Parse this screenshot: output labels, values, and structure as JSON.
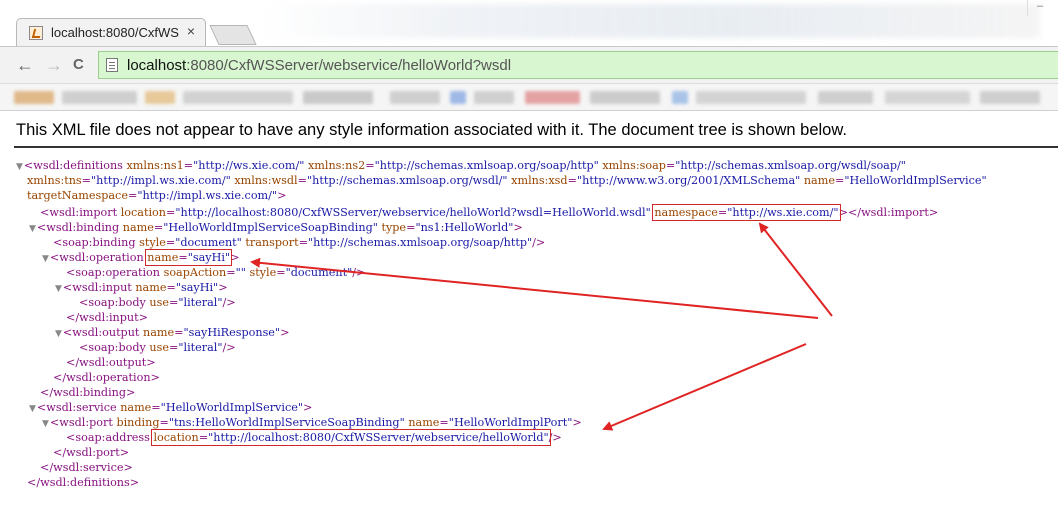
{
  "browser": {
    "tab_title": "localhost:8080/CxfWS",
    "tab_close": "×",
    "url_host": "localhost",
    "url_path": ":8080/CxfWSServer/webservice/helloWorld?wsdl",
    "back_glyph": "←",
    "forward_glyph": "→",
    "reload_glyph": "C",
    "minimize_glyph": "–"
  },
  "page": {
    "info": "This XML file does not appear to have any style information associated with it. The document tree is shown below."
  },
  "xml": {
    "defs_tag": "<wsdl:definitions",
    "ns1_name": "xmlns:ns1",
    "ns1_val": "\"http://ws.xie.com/\"",
    "ns2_name": "xmlns:ns2",
    "ns2_val": "\"http://schemas.xmlsoap.org/soap/http\"",
    "soap_name": "xmlns:soap",
    "soap_val": "\"http://schemas.xmlsoap.org/wsdl/soap/\"",
    "tns_name": "xmlns:tns",
    "tns_val": "\"http://impl.ws.xie.com/\"",
    "wsdl_name": "xmlns:wsdl",
    "wsdl_val": "\"http://schemas.xmlsoap.org/wsdl/\"",
    "xsd_name": "xmlns:xsd",
    "xsd_val": "\"http://www.w3.org/2001/XMLSchema\"",
    "defname_name": "name",
    "defname_val": "\"HelloWorldImplService\"",
    "tgt_name": "targetNamespace",
    "tgt_val": "\"http://impl.ws.xie.com/\"",
    "import_tag": "<wsdl:import",
    "import_loc_name": "location",
    "import_loc_val": "\"http://localhost:8080/CxfWSServer/webservice/helloWorld?wsdl=HelloWorld.wsdl\"",
    "import_ns_name": "namespace",
    "import_ns_val": "\"http://ws.xie.com/\"",
    "import_close": "</wsdl:import>",
    "binding_tag": "<wsdl:binding",
    "binding_name_name": "name",
    "binding_name_val": "\"HelloWorldImplServiceSoapBinding\"",
    "binding_type_name": "type",
    "binding_type_val": "\"ns1:HelloWorld\"",
    "soapbinding_tag": "<soap:binding",
    "style_name": "style",
    "style_val": "\"document\"",
    "transport_name": "transport",
    "transport_val": "\"http://schemas.xmlsoap.org/soap/http\"",
    "op_tag": "<wsdl:operation",
    "op_name_name": "name",
    "op_name_val": "\"sayHi\"",
    "soapop_tag": "<soap:operation",
    "soapaction_name": "soapAction",
    "soapaction_val": "\"\"",
    "opstyle_name": "style",
    "opstyle_val": "\"document\"",
    "input_tag": "<wsdl:input",
    "input_name_name": "name",
    "input_name_val": "\"sayHi\"",
    "body_tag": "<soap:body",
    "use_name": "use",
    "use_val": "\"literal\"",
    "input_close": "</wsdl:input>",
    "output_tag": "<wsdl:output",
    "output_name_name": "name",
    "output_name_val": "\"sayHiResponse\"",
    "output_close": "</wsdl:output>",
    "op_close": "</wsdl:operation>",
    "binding_close": "</wsdl:binding>",
    "service_tag": "<wsdl:service",
    "service_name_name": "name",
    "service_name_val": "\"HelloWorldImplService\"",
    "port_tag": "<wsdl:port",
    "port_binding_name": "binding",
    "port_binding_val": "\"tns:HelloWorldImplServiceSoapBinding\"",
    "port_name_name": "name",
    "port_name_val": "\"HelloWorldImplPort\"",
    "address_tag": "<soap:address",
    "address_loc_name": "location",
    "address_loc_val": "\"http://localhost:8080/CxfWSServer/webservice/helloWorld\"",
    "port_close": "</wsdl:port>",
    "service_close": "</wsdl:service>",
    "defs_close": "</wsdl:definitions>",
    "gt": ">",
    "selfclose": "/>",
    "eq": "=",
    "collapse_glyph": "▼"
  },
  "colors": {
    "tag": "#881280",
    "attr_name": "#994500",
    "attr_value": "#1a1aa6",
    "highlight": "#d0282a",
    "omnibox": "#d8f6d0"
  },
  "icons": [
    "favicon-icon",
    "back-arrow-icon",
    "forward-arrow-icon",
    "reload-icon",
    "page-icon",
    "collapse-triangle-icon"
  ]
}
